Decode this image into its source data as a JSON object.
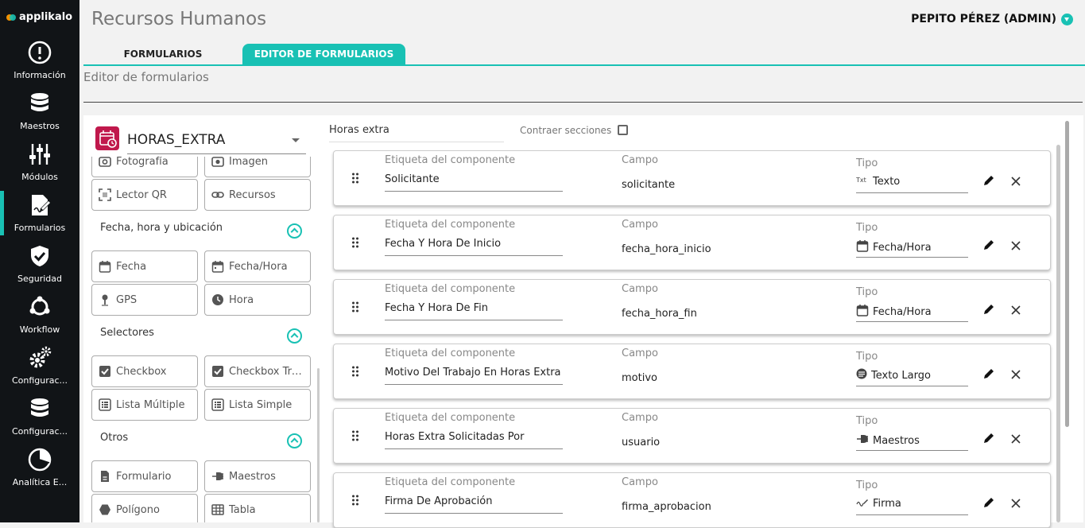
{
  "brand": {
    "name": "applikalo"
  },
  "sidebar": {
    "items": [
      {
        "label": "Información",
        "icon": "info-icon",
        "active": false
      },
      {
        "label": "Maestros",
        "icon": "database-icon",
        "active": false
      },
      {
        "label": "Módulos",
        "icon": "sliders-icon",
        "active": false
      },
      {
        "label": "Formularios",
        "icon": "form-edit-icon",
        "active": true
      },
      {
        "label": "Seguridad",
        "icon": "shield-check-icon",
        "active": false
      },
      {
        "label": "Workflow",
        "icon": "workflow-icon",
        "active": false
      },
      {
        "label": "Configurac...",
        "icon": "gears-icon",
        "active": false
      },
      {
        "label": "Configurac...",
        "icon": "database-icon",
        "active": false
      },
      {
        "label": "Analítica E...",
        "icon": "pie-chart-icon",
        "active": false
      }
    ]
  },
  "header": {
    "title": "Recursos Humanos",
    "user": "PEPITO PÉREZ (ADMIN)"
  },
  "tabs": [
    {
      "label": "FORMULARIOS",
      "active": false
    },
    {
      "label": "EDITOR DE FORMULARIOS",
      "active": true
    }
  ],
  "page": {
    "subtitle": "Editor de formularios"
  },
  "form": {
    "name": "HORAS_EXTRA",
    "icon": "calendar-clock-icon",
    "icon_color": "#c0184c"
  },
  "palette": {
    "top_items": [
      {
        "label": "Fotografía",
        "icon": "camera-icon"
      },
      {
        "label": "Imagen",
        "icon": "image-icon"
      },
      {
        "label": "Lector QR",
        "icon": "qr-scan-icon"
      },
      {
        "label": "Recursos",
        "icon": "link-icon"
      }
    ],
    "sections": [
      {
        "title": "Fecha, hora y ubicación",
        "items": [
          {
            "label": "Fecha",
            "icon": "calendar-icon"
          },
          {
            "label": "Fecha/Hora",
            "icon": "calendar-clock-icon"
          },
          {
            "label": "GPS",
            "icon": "pin-icon"
          },
          {
            "label": "Hora",
            "icon": "clock-icon"
          }
        ]
      },
      {
        "title": "Selectores",
        "items": [
          {
            "label": "Checkbox",
            "icon": "checkbox-icon"
          },
          {
            "label": "Checkbox Tres...",
            "icon": "checkbox-icon"
          },
          {
            "label": "Lista Múltiple",
            "icon": "list-icon"
          },
          {
            "label": "Lista Simple",
            "icon": "list-icon"
          }
        ]
      },
      {
        "title": "Otros",
        "items": [
          {
            "label": "Formulario",
            "icon": "document-icon"
          },
          {
            "label": "Maestros",
            "icon": "plug-icon"
          },
          {
            "label": "Polígono",
            "icon": "hexagon-icon"
          },
          {
            "label": "Tabla",
            "icon": "table-icon"
          }
        ]
      }
    ]
  },
  "editor": {
    "section_name": "Horas extra",
    "collapse_label": "Contraer secciones",
    "collapse_checked": false,
    "headers": {
      "label": "Etiqueta del componente",
      "field": "Campo",
      "type": "Tipo"
    },
    "components": [
      {
        "label": "Solicitante",
        "field": "solicitante",
        "type": "Texto",
        "type_icon": "text-type-icon"
      },
      {
        "label": "Fecha Y Hora De Inicio",
        "field": "fecha_hora_inicio",
        "type": "Fecha/Hora",
        "type_icon": "calendar-icon"
      },
      {
        "label": "Fecha Y Hora De Fin",
        "field": "fecha_hora_fin",
        "type": "Fecha/Hora",
        "type_icon": "calendar-icon"
      },
      {
        "label": "Motivo Del Trabajo En Horas Extra",
        "field": "motivo",
        "type": "Texto Largo",
        "type_icon": "long-text-icon"
      },
      {
        "label": "Horas Extra Solicitadas Por",
        "field": "usuario",
        "type": "Maestros",
        "type_icon": "plug-icon"
      },
      {
        "label": "Firma De Aprobación",
        "field": "firma_aprobacion",
        "type": "Firma",
        "type_icon": "signature-icon"
      }
    ]
  },
  "colors": {
    "accent": "#19c1b4",
    "sidebar_bg": "#111417",
    "form_icon": "#c0184c"
  }
}
